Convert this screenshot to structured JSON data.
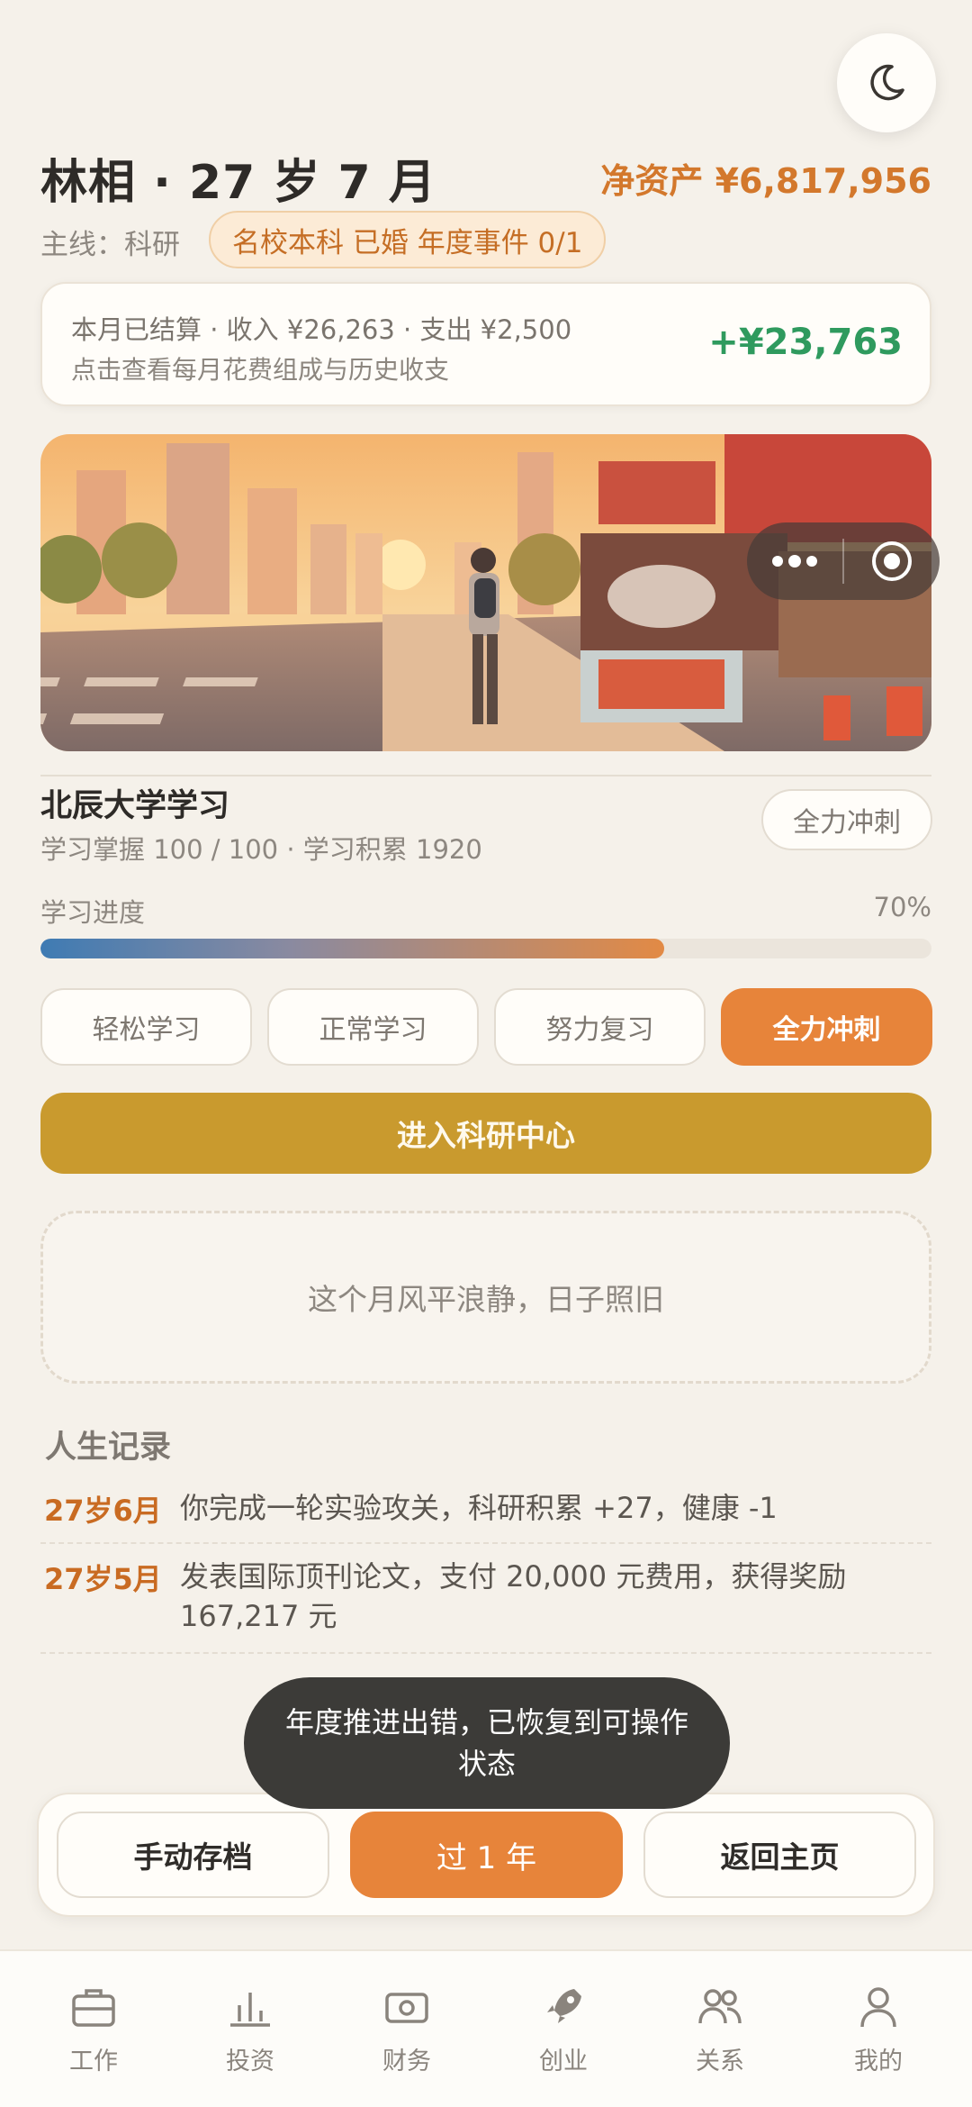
{
  "header": {
    "title": "林相 · 27 岁 7 月",
    "net_worth": "净资产 ¥6,817,956",
    "mainline": "主线：科研",
    "tags": "名校本科 已婚 年度事件 0/1"
  },
  "icons": {
    "theme_toggle": "moon-icon",
    "more": "more-dots-icon",
    "target": "target-icon"
  },
  "settlement": {
    "summary": "本月已结算 · 收入 ¥26,263 · 支出 ¥2,500",
    "hint": "点击查看每月花费组成与历史收支",
    "net": "+¥23,763"
  },
  "study": {
    "title": "北辰大学学习",
    "stats": "学习掌握 100 / 100 · 学习积累 1920",
    "current_mode": "全力冲刺",
    "progress_label": "学习进度",
    "progress_text": "70%",
    "progress_value": 0.7,
    "options": [
      {
        "label": "轻松学习",
        "active": false
      },
      {
        "label": "正常学习",
        "active": false
      },
      {
        "label": "努力复习",
        "active": false
      },
      {
        "label": "全力冲刺",
        "active": true
      }
    ],
    "research_button": "进入科研中心"
  },
  "event": {
    "text": "这个月风平浪静，日子照旧"
  },
  "records": {
    "title": "人生记录",
    "items": [
      {
        "age": "27岁6月",
        "text": "你完成一轮实验攻关，科研积累 +27，健康 -1"
      },
      {
        "age": "27岁5月",
        "text": "发表国际顶刊论文，支付 20,000 元费用，获得奖励 167,217 元"
      }
    ]
  },
  "toast": {
    "text": "年度推进出错，已恢复到可操作状态"
  },
  "actions": {
    "save": "手动存档",
    "advance": "过 1 年",
    "home": "返回主页"
  },
  "nav": [
    {
      "label": "工作",
      "icon": "briefcase-icon"
    },
    {
      "label": "投资",
      "icon": "bar-chart-icon"
    },
    {
      "label": "财务",
      "icon": "cash-icon"
    },
    {
      "label": "创业",
      "icon": "rocket-icon"
    },
    {
      "label": "关系",
      "icon": "people-icon"
    },
    {
      "label": "我的",
      "icon": "person-icon"
    }
  ],
  "colors": {
    "accent": "#e7843a",
    "gold": "#c99a2e",
    "positive": "#2f9a5e",
    "background": "#f5f1ea"
  }
}
